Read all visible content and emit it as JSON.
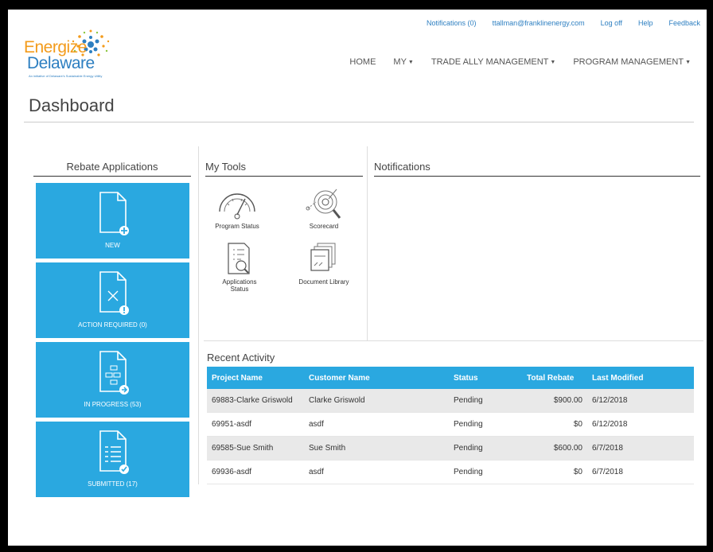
{
  "logo": {
    "line1": "Energize",
    "line2": "Delaware",
    "tagline": "An initiative of Delaware's Sustainable Energy Utility"
  },
  "toplinks": [
    "Notifications (0)",
    "ttallman@franklinenergy.com",
    "Log off",
    "Help",
    "Feedback"
  ],
  "nav": {
    "home": "HOME",
    "my": "MY",
    "trade": "TRADE ALLY MANAGEMENT",
    "program": "PROGRAM MANAGEMENT"
  },
  "page_title": "Dashboard",
  "rebate": {
    "heading": "Rebate Applications",
    "tiles": [
      {
        "label": "NEW",
        "icon": "new-document-icon"
      },
      {
        "label": "ACTION REQUIRED (0)",
        "icon": "action-required-document-icon"
      },
      {
        "label": "IN PROGRESS (53)",
        "icon": "in-progress-document-icon"
      },
      {
        "label": "SUBMITTED (17)",
        "icon": "submitted-document-icon"
      }
    ],
    "tile_color": "#2aa8e0"
  },
  "tools": {
    "heading": "My Tools",
    "items": [
      {
        "label": "Program Status",
        "icon": "gauge-icon"
      },
      {
        "label": "Scorecard",
        "icon": "target-icon"
      },
      {
        "label": "Applications Status",
        "icon": "document-magnifier-icon"
      },
      {
        "label": "Document Library",
        "icon": "document-stack-icon"
      }
    ]
  },
  "notifications": {
    "heading": "Notifications"
  },
  "recent": {
    "heading": "Recent Activity",
    "columns": [
      "Project Name",
      "Customer Name",
      "Status",
      "Total Rebate",
      "Last Modified"
    ],
    "rows": [
      [
        "69883-Clarke Griswold",
        "Clarke Griswold",
        "Pending",
        "$900.00",
        "6/12/2018"
      ],
      [
        "69951-asdf",
        "asdf",
        "Pending",
        "$0",
        "6/12/2018"
      ],
      [
        "69585-Sue Smith",
        "Sue Smith",
        "Pending",
        "$600.00",
        "6/7/2018"
      ],
      [
        "69936-asdf",
        "asdf",
        "Pending",
        "$0",
        "6/7/2018"
      ]
    ]
  }
}
